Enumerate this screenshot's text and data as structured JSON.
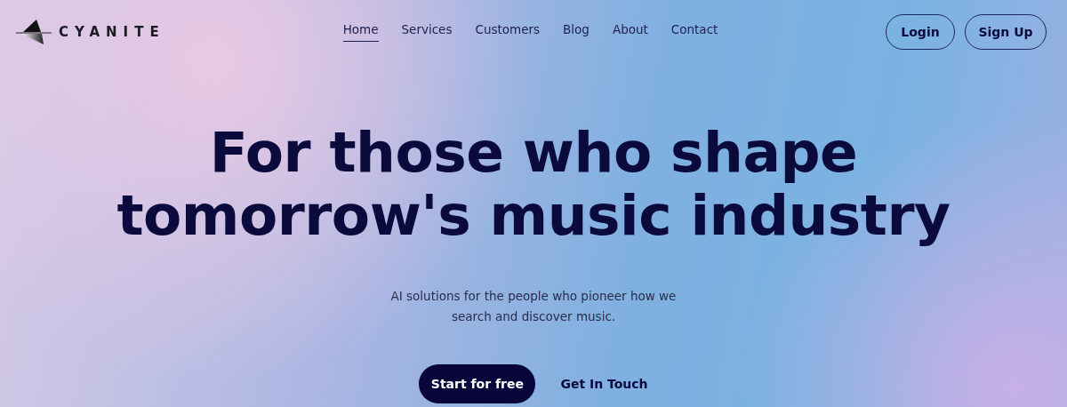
{
  "logo": {
    "text": "CYANITE"
  },
  "nav": [
    {
      "label": "Home",
      "selected": true
    },
    {
      "label": "Services",
      "selected": false
    },
    {
      "label": "Customers",
      "selected": false
    },
    {
      "label": "Blog",
      "selected": false
    },
    {
      "label": "About",
      "selected": false
    },
    {
      "label": "Contact",
      "selected": false
    }
  ],
  "auth_buttons": [
    "Login",
    "Sign Up"
  ],
  "hero": {
    "title_lines": [
      "For those who shape",
      "tomorrow's music industry"
    ],
    "subtitle": "AI solutions for the people who pioneer how we search and discover music.",
    "primary_button": "Start for free",
    "secondary_button": "Get In Touch"
  }
}
